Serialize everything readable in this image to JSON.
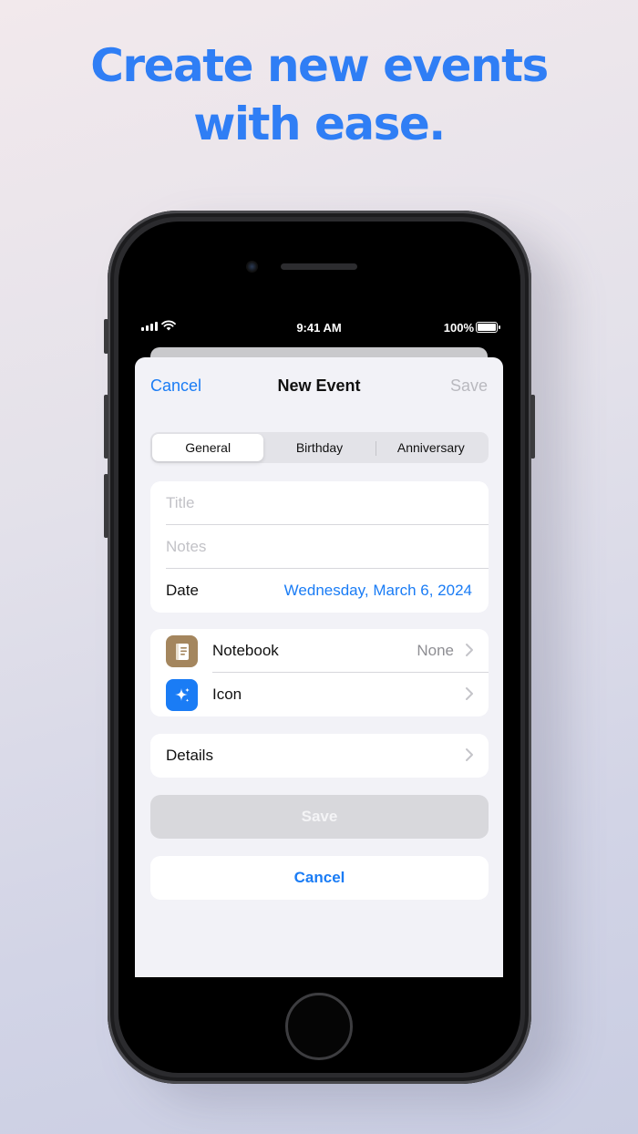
{
  "headline": {
    "line1": "Create new events",
    "line2": "with ease."
  },
  "status_bar": {
    "time": "9:41 AM",
    "battery": "100%"
  },
  "nav": {
    "cancel": "Cancel",
    "title": "New Event",
    "save": "Save"
  },
  "segments": {
    "items": [
      "General",
      "Birthday",
      "Anniversary"
    ],
    "selected": "General"
  },
  "form": {
    "title_placeholder": "Title",
    "notes_placeholder": "Notes",
    "date_label": "Date",
    "date_value": "Wednesday, March 6, 2024"
  },
  "options": {
    "notebook_label": "Notebook",
    "notebook_value": "None",
    "icon_label": "Icon"
  },
  "details": {
    "label": "Details"
  },
  "buttons": {
    "save": "Save",
    "cancel": "Cancel"
  },
  "colors": {
    "accent": "#1a7cf5",
    "headline": "#2f7ef5",
    "notebook_icon": "#a4865e",
    "disabled_button": "#d8d8dc"
  },
  "icons": {
    "notebook": "notebook-icon",
    "sparkle": "sparkle-icon",
    "chevron": "chevron-right-icon"
  }
}
